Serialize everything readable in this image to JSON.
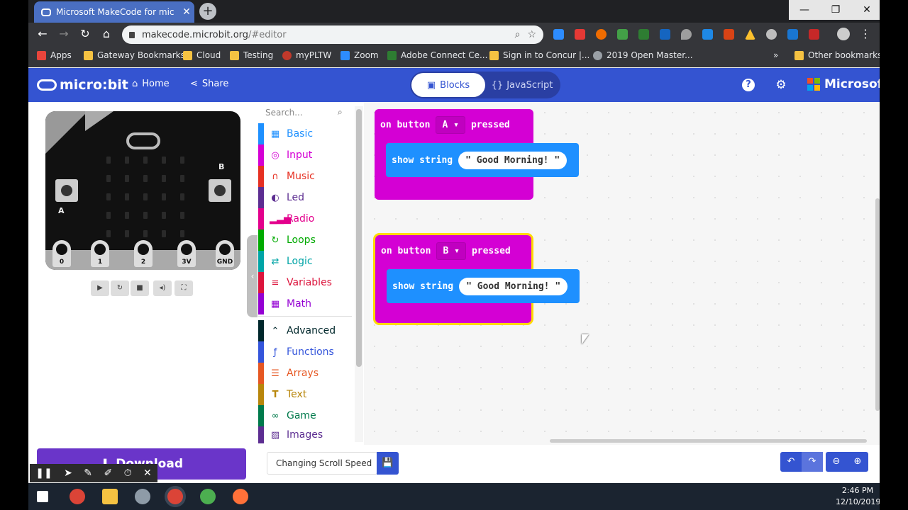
{
  "browser": {
    "tab_title": "Microsoft MakeCode for micro:bit",
    "url_host": "makecode.microbit.org",
    "url_path": "/#editor",
    "bookmarks": [
      {
        "label": "Apps",
        "color": "#e8453c"
      },
      {
        "label": "Gateway Bookmarks",
        "color": "#f5c242"
      },
      {
        "label": "Cloud",
        "color": "#f5c242"
      },
      {
        "label": "Testing",
        "color": "#f5c242"
      },
      {
        "label": "myPLTW",
        "color": "#c0392b"
      },
      {
        "label": "Zoom",
        "color": "#2d8cff"
      },
      {
        "label": "Adobe Connect Ce...",
        "color": "#2e7d32"
      },
      {
        "label": "Sign in to Concur |...",
        "color": "#f5c242"
      },
      {
        "label": "2019 Open Master...",
        "color": "#9aa0a6"
      }
    ],
    "other_bookmarks": "Other bookmarks",
    "overflow": "»"
  },
  "header": {
    "logo": "micro:bit",
    "home": "Home",
    "share": "Share",
    "blocks": "Blocks",
    "javascript": "JavaScript",
    "help": "?",
    "brand": "Microsoft"
  },
  "simulator": {
    "pins": [
      "0",
      "1",
      "2",
      "3V",
      "GND"
    ],
    "button_a": "A",
    "button_b": "B"
  },
  "toolbox": {
    "search_placeholder": "Search...",
    "categories": [
      {
        "label": "Basic",
        "color": "#1e90ff",
        "icon": "grid-icon"
      },
      {
        "label": "Input",
        "color": "#d400d4",
        "icon": "target-icon"
      },
      {
        "label": "Music",
        "color": "#e63022",
        "icon": "headphones-icon"
      },
      {
        "label": "Led",
        "color": "#5c2d91",
        "icon": "toggle-icon"
      },
      {
        "label": "Radio",
        "color": "#e3008c",
        "icon": "signal-icon"
      },
      {
        "label": "Loops",
        "color": "#00aa00",
        "icon": "loop-icon"
      },
      {
        "label": "Logic",
        "color": "#00a4a6",
        "icon": "shuffle-icon"
      },
      {
        "label": "Variables",
        "color": "#dc143c",
        "icon": "lines-icon"
      },
      {
        "label": "Math",
        "color": "#9400d3",
        "icon": "calculator-icon"
      },
      {
        "label": "Advanced",
        "color": "#00272b",
        "icon": "chevron-up-icon"
      },
      {
        "label": "Functions",
        "color": "#3455db",
        "icon": "function-icon"
      },
      {
        "label": "Arrays",
        "color": "#e65722",
        "icon": "list-icon"
      },
      {
        "label": "Text",
        "color": "#b8860b",
        "icon": "text-icon"
      },
      {
        "label": "Game",
        "color": "#007a4b",
        "icon": "gamepad-icon"
      },
      {
        "label": "Images",
        "color": "#5c2d91",
        "icon": "image-icon"
      }
    ]
  },
  "workspace": {
    "blocks": [
      {
        "on": "on button",
        "button": "A",
        "pressed": "pressed",
        "show": "show string",
        "text": "\" Good Morning! \""
      },
      {
        "on": "on button",
        "button": "B",
        "pressed": "pressed",
        "show": "show string",
        "text": "\" Good Morning! \""
      }
    ]
  },
  "footer": {
    "download": "Download",
    "project_name": "Changing Scroll Speed"
  },
  "taskbar": {
    "time": "2:46 PM",
    "date": "12/10/2019"
  }
}
